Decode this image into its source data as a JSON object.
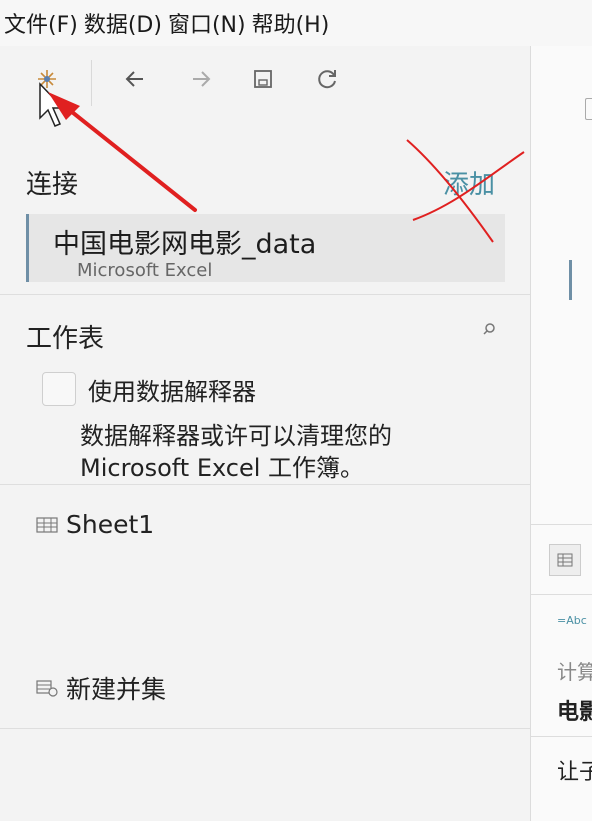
{
  "menubar": {
    "items": [
      "文件(F)",
      "数据(D)",
      "窗口(N)",
      "帮助(H)"
    ]
  },
  "toolbar": {
    "buttons": [
      "data-source-icon",
      "back-arrow-icon",
      "forward-arrow-icon",
      "save-icon",
      "refresh-icon"
    ]
  },
  "connections": {
    "title": "连接",
    "add_label": "添加",
    "items": [
      {
        "name": "中国电影网电影_data",
        "type": "Microsoft Excel"
      }
    ]
  },
  "worksheets": {
    "title": "工作表",
    "interpreter_label": "使用数据解释器",
    "interpreter_help": "数据解释器或许可以清理您的 Microsoft Excel 工作簿。",
    "sheets": [
      "Sheet1"
    ],
    "new_union_label": "新建并集"
  },
  "right_panel": {
    "type_badge": "=Abc",
    "fragments": [
      "计算",
      "电影",
      "让子"
    ]
  },
  "annotation": {
    "arrow_color": "#e02020",
    "cross_color": "#e02020"
  }
}
